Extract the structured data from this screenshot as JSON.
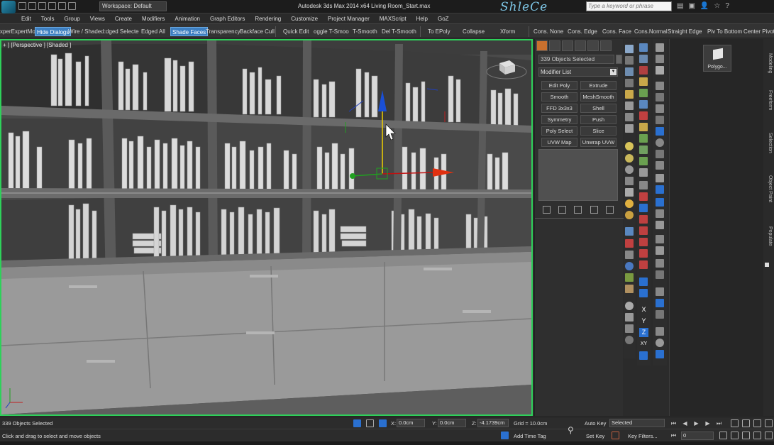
{
  "titlebar": {
    "workspace": "Workspace: Default",
    "title": "Autodesk 3ds Max  2014 x64     Living Room_Start.max",
    "brand": "ShleCe",
    "search_placeholder": "Type a keyword or phrase"
  },
  "menu": [
    "Edit",
    "Tools",
    "Group",
    "Views",
    "Create",
    "Modifiers",
    "Animation",
    "Graph Editors",
    "Rendering",
    "Customize",
    "Project Manager",
    "MAXScript",
    "Help",
    "GoZ"
  ],
  "ribbon": {
    "expert_mode": "xperExpertMo",
    "hide_dialogs": "Hide Dialogs",
    "wire_shaded": "Wire / Shaded:dged Selecte",
    "edged_all": "Edged All",
    "shade_faces": "Shade Faces",
    "transparency": "Transparency",
    "backface_cull": "Backface Cull",
    "quick_edit": "Quick Edit",
    "toggle_tsmooth": "oggle T-Smoo",
    "tsmooth": "T-Smooth",
    "del_tsmooth": "Del T-Smooth",
    "to_epoly": "To  EPoly",
    "collapse": "Collapse",
    "xform": "Xform",
    "cons_none": "Cons. None",
    "cons_edge": "Cons. Edge",
    "cons_face": "Cons. Face",
    "cons_normal": "Cons.Normal",
    "straight_edge": "Straight Edge",
    "piv_to_bottom": "Piv To Bottom",
    "center_pivot": "Center Pivot"
  },
  "viewport": {
    "label": "+ ] [Perspective ] [Shaded ]",
    "bg_color": "#474747",
    "border_color": "#2ed15a"
  },
  "command_panel": {
    "selection_name": "339 Objects Selected",
    "modifier_list": "Modifier List",
    "modifiers": [
      "Edit Poly",
      "Extrude",
      "Smooth",
      "MeshSmooth",
      "FFD 3x3x3",
      "Shell",
      "Symmetry",
      "Push",
      "Poly Select",
      "Slice",
      "UVW Map",
      "Unwrap UVW"
    ]
  },
  "axis_buttons": [
    "X",
    "Y",
    "Z",
    "XY"
  ],
  "scene_panel": {
    "tile_label": "Polygo..."
  },
  "vertical_tabs": [
    "Modeling",
    "Freeform",
    "Selection",
    "Object Paint",
    "Populate"
  ],
  "status": {
    "objects_selected": "339 Objects Selected",
    "prompt": "Click and drag to select and move objects",
    "x_label": "X:",
    "x_value": "0.0cm",
    "y_label": "Y:",
    "y_value": "0.0cm",
    "z_label": "Z:",
    "z_value": "-4.1739cm",
    "grid": "Grid = 10.0cm",
    "add_time_tag": "Add Time Tag",
    "auto_key": "Auto Key",
    "set_key": "Set Key",
    "selected_dropdown": "Selected",
    "key_filters": "Key Filters...",
    "frame": "0"
  }
}
